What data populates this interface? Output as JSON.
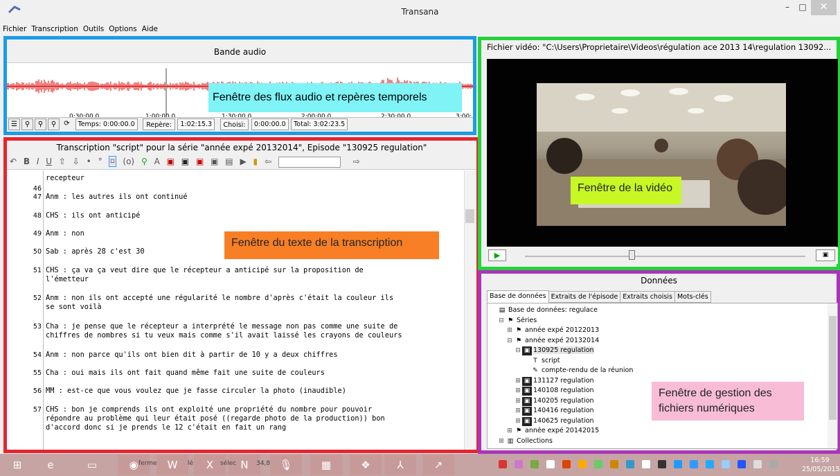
{
  "window": {
    "title": "Transana",
    "minimize": "–",
    "maximize": "□",
    "close": "✕"
  },
  "menu": [
    "Fichier",
    "Transcription",
    "Outils",
    "Options",
    "Aide"
  ],
  "audio": {
    "title": "Bande audio",
    "ticks": [
      "0:30:00.0",
      "1:00:00.0",
      "1:30:00.0",
      "2:00:00.0",
      "2:30:00.0",
      "3:00:"
    ],
    "temps_label": "Temps: 0:00:00.0",
    "repere_label": "Repère:",
    "repere_value": "1:02:15.3",
    "choisi_label": "Choisi:",
    "choisi_value": "0:00:00.0",
    "total_label": "Total: 3:02:23.5",
    "note": "Fenêtre des flux audio et repères temporels",
    "wave_color": "#e00000"
  },
  "transcript": {
    "title": "Transcription \"script\" pour la série \"année expé 20132014\", Episode \"130925 regulation\"",
    "toolbar": [
      "↶",
      "B",
      "I",
      "U",
      "⇧",
      "⇩",
      "•",
      "°",
      "⌑",
      "(o)",
      "⚲",
      "A",
      "▣",
      "▣",
      "▣",
      "▣",
      "▤",
      "▶",
      "▮",
      "⇦",
      "",
      "⇨"
    ],
    "lines": [
      {
        "num": "",
        "text": "recepteur"
      },
      {
        "num": "46",
        "text": ""
      },
      {
        "num": "47",
        "text": "Anm : les autres ils ont continué"
      },
      {
        "num": "48",
        "text": "CHS : ils ont anticipé"
      },
      {
        "num": "49",
        "text": "Anm : non"
      },
      {
        "num": "50",
        "text": "Sab : après 28 c'est 30"
      },
      {
        "num": "51",
        "text": "CHS : ça va ça veut dire que le récepteur a anticipé sur la proposition de\nl'émetteur"
      },
      {
        "num": "52",
        "text": "Anm : non ils ont accepté une régularité le nombre d'après c'était la couleur ils\nse sont voilà"
      },
      {
        "num": "53",
        "text": "Cha : je pense que le récepteur a interprété le message non pas comme une suite de\nchiffres de nombres si tu veux mais comme s'il avait laissé les crayons de couleurs"
      },
      {
        "num": "54",
        "text": "Anm : non parce qu'ils ont bien dit à partir de 10 y a deux chiffres"
      },
      {
        "num": "55",
        "text": "Cha : oui mais ils ont fait quand même fait une suite de couleurs"
      },
      {
        "num": "56",
        "text": "MM : est-ce que vous voulez que je fasse circuler la photo (inaudible)"
      },
      {
        "num": "57",
        "text": "CHS : bon je comprends ils ont exploité une propriété du nombre pour pouvoir\nrépondre au problème qui leur était posé ((regarde photo de la production)) bon\nd'accord donc si je prends le 12 c'était en fait un rang"
      }
    ],
    "note": "Fenêtre du texte de la transcription"
  },
  "video": {
    "title": "Fichier vidéo: \"C:\\Users\\Proprietaire\\Videos\\régulation ace 2013 14\\regulation 13092...",
    "note": "Fenêtre de la vidéo",
    "play": "▶",
    "snapshot": "▣",
    "position_fraction": 0.38
  },
  "data": {
    "title": "Données",
    "tabs": [
      "Base de données",
      "Extraits de l'épisode",
      "Extraits choisis",
      "Mots-clés"
    ],
    "tree": [
      {
        "label": "Base de données: regulace",
        "icon": "database-icon",
        "level": 0,
        "exp": ""
      },
      {
        "label": "Séries",
        "icon": "series-icon",
        "level": 1,
        "exp": "⊟"
      },
      {
        "label": "année expé 20122013",
        "icon": "series-icon",
        "level": 2,
        "exp": "⊞"
      },
      {
        "label": "année expé 20132014",
        "icon": "series-icon",
        "level": 2,
        "exp": "⊟"
      },
      {
        "label": "130925 regulation",
        "icon": "episode-icon",
        "level": 3,
        "exp": "⊟"
      },
      {
        "label": "script",
        "icon": "transcript-icon",
        "level": 4,
        "exp": ""
      },
      {
        "label": "compte-rendu de la réunion",
        "icon": "note-icon",
        "level": 4,
        "exp": ""
      },
      {
        "label": "131127 regulation",
        "icon": "episode-icon",
        "level": 3,
        "exp": "⊞"
      },
      {
        "label": "140108 regulation",
        "icon": "episode-icon",
        "level": 3,
        "exp": "⊞"
      },
      {
        "label": "140205 regulation",
        "icon": "episode-icon",
        "level": 3,
        "exp": "⊞"
      },
      {
        "label": "140416 regulation",
        "icon": "episode-icon",
        "level": 3,
        "exp": "⊞"
      },
      {
        "label": "140625 regulation",
        "icon": "episode-icon",
        "level": 3,
        "exp": "⊞"
      },
      {
        "label": "année expé 20142015",
        "icon": "series-icon",
        "level": 2,
        "exp": "⊞"
      },
      {
        "label": "Collections",
        "icon": "collections-icon",
        "level": 1,
        "exp": "⊞"
      }
    ],
    "note": "Fenêtre de gestion des fichiers numériques"
  },
  "taskbar": {
    "items": [
      {
        "name": "start-icon",
        "glyph": "⊞"
      },
      {
        "name": "ie-icon",
        "glyph": "e"
      },
      {
        "name": "explorer-icon",
        "glyph": "▭"
      },
      {
        "name": "firefox-icon",
        "glyph": "◉"
      },
      {
        "name": "word-icon",
        "glyph": "W"
      },
      {
        "name": "excel-icon",
        "glyph": "X"
      },
      {
        "name": "onenote-icon",
        "glyph": "N"
      },
      {
        "name": "mic-icon",
        "glyph": "🎙"
      },
      {
        "name": "app-icon",
        "glyph": "▦"
      },
      {
        "name": "dropbox-icon",
        "glyph": "❖"
      },
      {
        "name": "acrobat-icon",
        "glyph": "⅄"
      },
      {
        "name": "transana-icon",
        "glyph": "↗"
      }
    ],
    "labels": [
      "ferme",
      "lé",
      "sélec",
      "34,8"
    ],
    "time": "16:59",
    "date": "25/05/2015"
  }
}
